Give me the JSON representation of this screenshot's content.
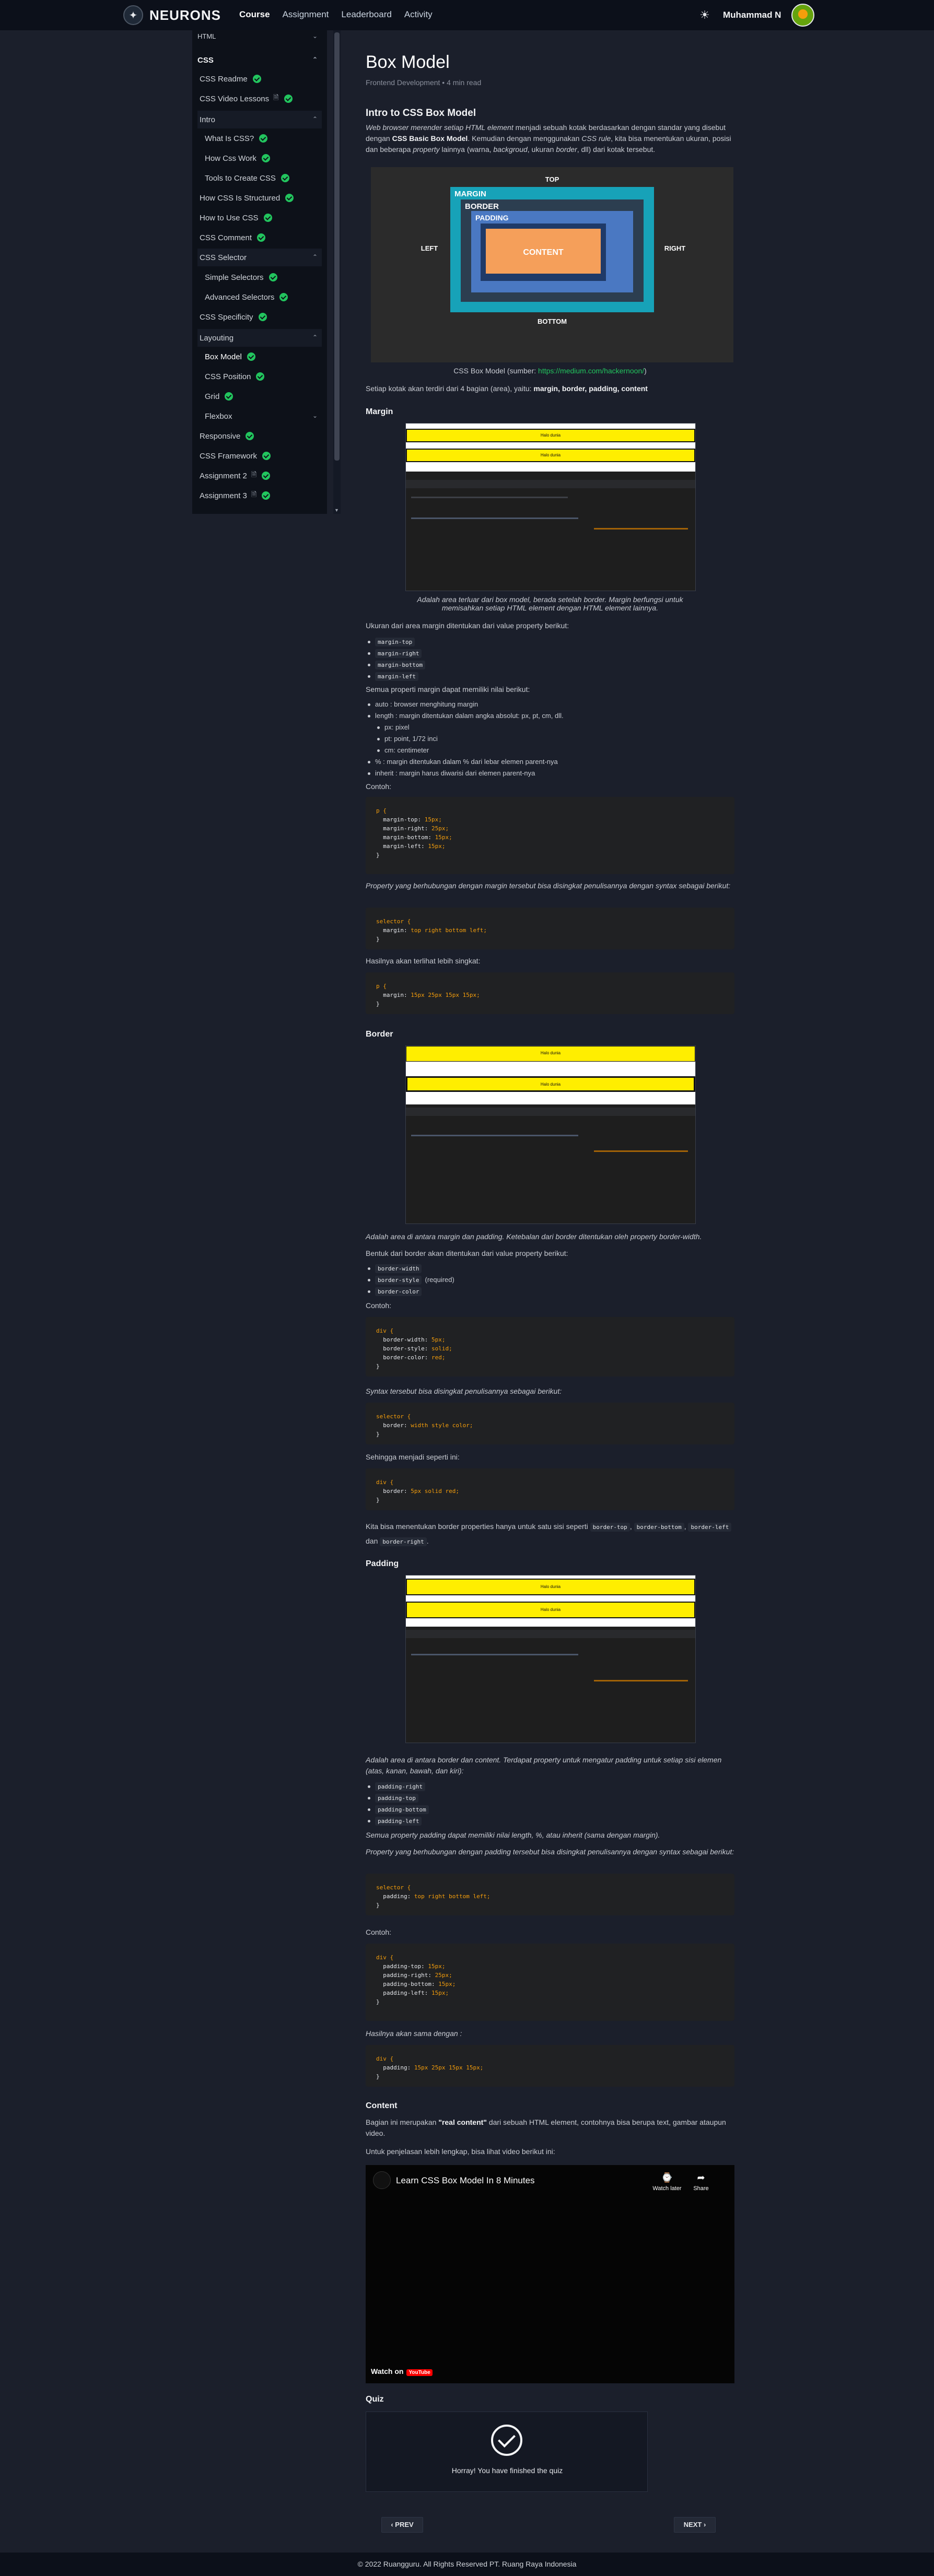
{
  "brand": {
    "name": "NEURONS"
  },
  "nav": {
    "items": [
      "Course",
      "Assignment",
      "Leaderboard",
      "Activity"
    ],
    "active": "Course"
  },
  "user": {
    "name": "Muhammad N"
  },
  "sidebar": {
    "html_label": "HTML",
    "css_label": "CSS",
    "items": [
      {
        "label": "CSS Readme",
        "done": true
      },
      {
        "label": "CSS Video Lessons",
        "done": true,
        "doc": true
      },
      {
        "label": "Intro",
        "section": true
      },
      {
        "label": "What Is CSS?",
        "done": true,
        "indent": true
      },
      {
        "label": "How Css Work",
        "done": true,
        "indent": true
      },
      {
        "label": "Tools to Create CSS",
        "done": true,
        "indent": true
      },
      {
        "label": "How CSS Is Structured",
        "done": true
      },
      {
        "label": "How to Use CSS",
        "done": true
      },
      {
        "label": "CSS Comment",
        "done": true
      },
      {
        "label": "CSS Selector",
        "section": true
      },
      {
        "label": "Simple Selectors",
        "done": true,
        "indent": true
      },
      {
        "label": "Advanced Selectors",
        "done": true,
        "indent": true
      },
      {
        "label": "CSS Specificity",
        "done": true
      },
      {
        "label": "Layouting",
        "section": true,
        "open": true
      },
      {
        "label": "Box Model",
        "done": true,
        "indent": true,
        "current": true
      },
      {
        "label": "CSS Position",
        "done": true,
        "indent": true
      },
      {
        "label": "Grid",
        "done": true,
        "indent": true
      },
      {
        "label": "Flexbox",
        "indent": true,
        "collapsed": true
      },
      {
        "label": "Responsive",
        "done": true
      },
      {
        "label": "CSS Framework",
        "done": true
      },
      {
        "label": "Assignment 2",
        "done": true,
        "doc": true
      },
      {
        "label": "Assignment 3",
        "done": true,
        "doc": true
      }
    ]
  },
  "article": {
    "title": "Box Model",
    "meta": "Frontend Development  •  4 min read",
    "intro_heading": "Intro to CSS Box Model",
    "intro_text": "Web browser merender setiap HTML element menjadi sebuah kotak berdasarkan dengan standar yang disebut dengan CSS Basic Box Model. Kemudian dengan menggunakan CSS rule, kita bisa menentukan ukuran, posisi dan beberapa property lainnya (warna, backgroud, ukuran border, dll) dari kotak tersebut.",
    "diagram": {
      "top": "TOP",
      "bottom": "BOTTOM",
      "left": "LEFT",
      "right": "RIGHT",
      "margin": "MARGIN",
      "border": "BORDER",
      "padding": "PADDING",
      "content": "CONTENT"
    },
    "diagram_caption_prefix": "CSS Box Model (sumber: ",
    "diagram_caption_link": "https://medium.com/hackernoon/",
    "diagram_caption_suffix": ")",
    "four_parts": "Setiap kotak akan terdiri dari 4 bagian (area), yaitu: margin, border, padding, content",
    "margin_heading": "Margin",
    "shot_text": "Halo dunia",
    "margin_caption": "Adalah area terluar dari box model, berada setelah border. Margin berfungsi untuk memisahkan setiap HTML element dengan HTML element lainnya.",
    "margin_size_intro": "Ukuran dari area margin ditentukan dari value property berikut:",
    "margin_props": [
      "margin-top",
      "margin-right",
      "margin-bottom",
      "margin-left"
    ],
    "margin_values_intro": "Semua properti margin dapat memiliki nilai berikut:",
    "margin_values": [
      "auto : browser menghitung margin",
      "length : margin ditentukan dalam angka absolut: px, pt, cm, dll.",
      "px: pixel",
      "pt: point, 1/72 inci",
      "cm: centimeter",
      "% : margin ditentukan dalam % dari lebar elemen parent-nya",
      "inherit : margin harus diwarisi dari elemen parent-nya"
    ],
    "contoh": "Contoh:",
    "margin_code1": "p {\n  margin-top: 15px;\n  margin-right: 25px;\n  margin-bottom: 15px;\n  margin-left: 15px;\n}",
    "margin_shorthand_intro": "Property yang berhubungan dengan margin tersebut bisa disingkat penulisannya dengan syntax sebagai berikut:",
    "margin_code2": "selector {\n  margin: top right bottom left;\n}",
    "margin_result_intro": "Hasilnya akan terlihat lebih singkat:",
    "margin_code3": "p {\n  margin: 15px 25px 15px 15px;\n}",
    "border_heading": "Border",
    "border_caption": "Adalah area di antara margin dan padding. Ketebalan dari border ditentukan oleh property border-width.",
    "border_props_intro": "Bentuk dari border akan ditentukan dari value property berikut:",
    "border_props": [
      "border-width",
      "border-style",
      "border-color"
    ],
    "border_required": "(required)",
    "border_code1": "div {\n  border-width: 5px;\n  border-style: solid;\n  border-color: red;\n}",
    "border_syntax_intro": "Syntax tersebut bisa disingkat penulisannya sebagai berikut:",
    "border_code2": "selector {\n  border: width style color;\n}",
    "border_result_intro": "Sehingga menjadi seperti ini:",
    "border_code3": "div {\n  border: 5px solid red;\n}",
    "border_note": "Kita bisa menentukan border properties hanya untuk satu sisi seperti",
    "border_sides": [
      "border-top",
      "border-bottom",
      "border-left",
      "border-right"
    ],
    "border_and": "dan",
    "padding_heading": "Padding",
    "padding_caption": "Adalah area di antara border dan content. Terdapat property untuk mengatur padding untuk setiap sisi elemen (atas, kanan, bawah, dan kiri):",
    "padding_props": [
      "padding-right",
      "padding-top",
      "padding-bottom",
      "padding-left"
    ],
    "padding_values": "Semua property padding dapat memiliki nilai length, %, atau inherit (sama dengan margin).",
    "padding_shorthand_intro": "Property yang berhubungan dengan padding tersebut bisa disingkat penulisannya dengan syntax sebagai berikut:",
    "padding_code1": "selector {\n  padding: top right bottom left;\n}",
    "padding_code2": "div {\n  padding-top: 15px;\n  padding-right: 25px;\n  padding-bottom: 15px;\n  padding-left: 15px;\n}",
    "padding_result_intro": "Hasilnya akan sama dengan :",
    "padding_code3": "div {\n  padding: 15px 25px 15px 15px;\n}",
    "content_heading": "Content",
    "content_text": "Bagian ini merupakan \"real content\" dari sebuah HTML element, contohnya bisa berupa text, gambar ataupun video.",
    "video_intro": "Untuk penjelasan lebih lengkap, bisa lihat video berikut ini:",
    "video": {
      "title": "Learn CSS Box Model In 8 Minutes",
      "watch_later": "Watch later",
      "share": "Share",
      "watch_on": "Watch on",
      "youtube": "YouTube"
    },
    "quiz_heading": "Quiz",
    "quiz_message": "Horray! You have finished the quiz",
    "prev": "‹ PREV",
    "next": "NEXT ›"
  },
  "footer": "© 2022 Ruangguru. All Rights Reserved PT. Ruang Raya Indonesia"
}
